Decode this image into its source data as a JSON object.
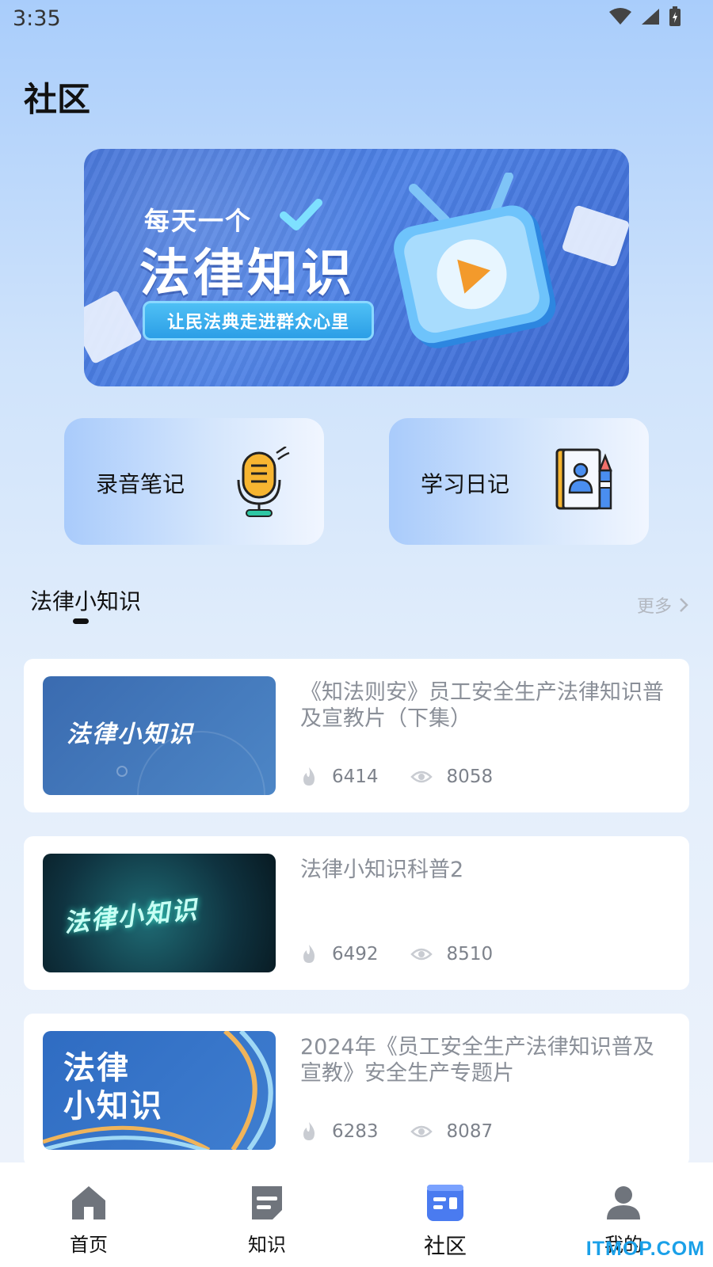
{
  "status_bar": {
    "time": "3:35"
  },
  "page_title": "社区",
  "banner": {
    "small_text": "每天一个",
    "big_text": "法律知识",
    "pill_text": "让民法典走进群众心里"
  },
  "quick_actions": [
    {
      "label": "录音笔记",
      "icon": "microphone-icon"
    },
    {
      "label": "学习日记",
      "icon": "diary-icon"
    }
  ],
  "section": {
    "title": "法律小知识",
    "more_label": "更多"
  },
  "items": [
    {
      "thumb_text": "法律小知识",
      "title": "《知法则安》员工安全生产法律知识普及宣教片（下集）",
      "likes": "6414",
      "views": "8058"
    },
    {
      "thumb_text": "法律小知识",
      "title": "法律小知识科普2",
      "likes": "6492",
      "views": "8510"
    },
    {
      "thumb_text_line1": "法律",
      "thumb_text_line2": "小知识",
      "title": "2024年《员工安全生产法律知识普及宣教》安全生产专题片",
      "likes": "6283",
      "views": "8087"
    }
  ],
  "tabs": [
    {
      "label": "首页",
      "icon": "home-icon",
      "active": false
    },
    {
      "label": "知识",
      "icon": "knowledge-icon",
      "active": false
    },
    {
      "label": "社区",
      "icon": "community-icon",
      "active": true
    },
    {
      "label": "我的",
      "icon": "profile-icon",
      "active": false
    }
  ],
  "watermark": "ITMOP.COM",
  "colors": {
    "accent": "#4a7bf0",
    "card_bg": "#ffffff",
    "muted_text": "#8a8f98"
  }
}
